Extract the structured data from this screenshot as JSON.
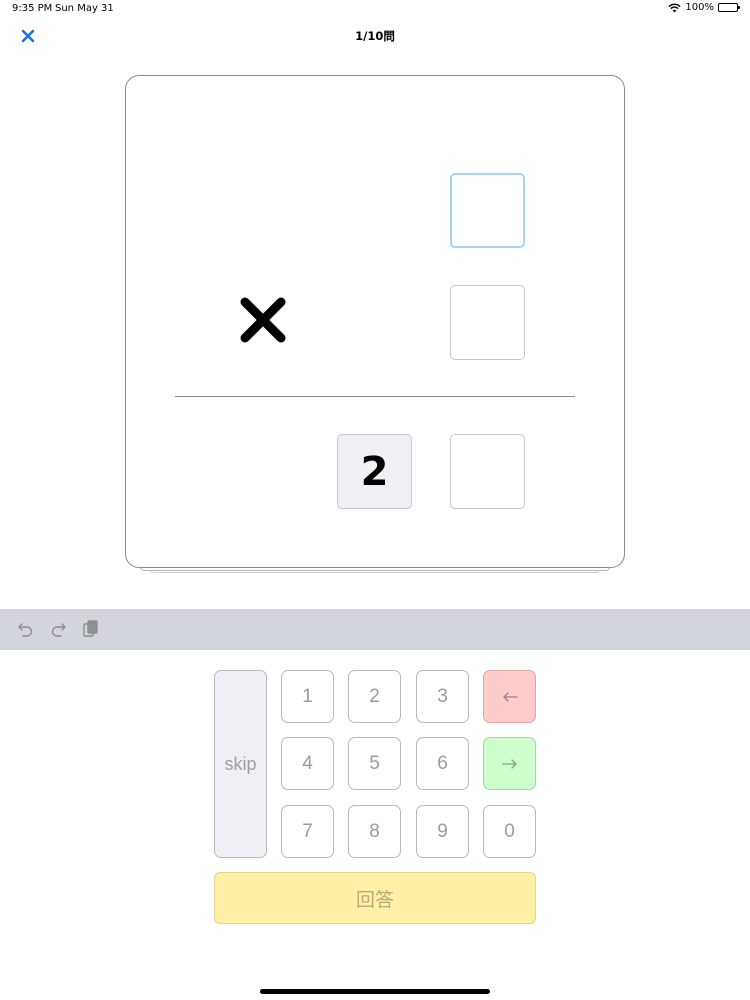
{
  "status_bar": {
    "time": "9:35 PM",
    "date": "Sun May 31",
    "battery": "100%"
  },
  "nav": {
    "close_icon": "close-icon",
    "title": "1/10問"
  },
  "problem": {
    "top_digit": "",
    "multiplier_digit": "",
    "answer_tens": "2",
    "answer_ones": "",
    "operator_icon": "multiply-icon"
  },
  "toolbar": {
    "icons": [
      "undo-icon",
      "redo-icon",
      "paste-icon"
    ]
  },
  "keypad": {
    "skip_label": "skip",
    "digits": [
      "1",
      "2",
      "3",
      "4",
      "5",
      "6",
      "7",
      "8",
      "9",
      "0"
    ],
    "back_label": "←",
    "forward_label": "→",
    "answer_label": "回答"
  },
  "colors": {
    "accent": "#1a73e8",
    "active_box": "#a9d3f2",
    "back_key": "#ffcccc",
    "forward_key": "#ccffcc",
    "answer_button": "#fff0a6",
    "toolbar": "#d3d5dc"
  }
}
